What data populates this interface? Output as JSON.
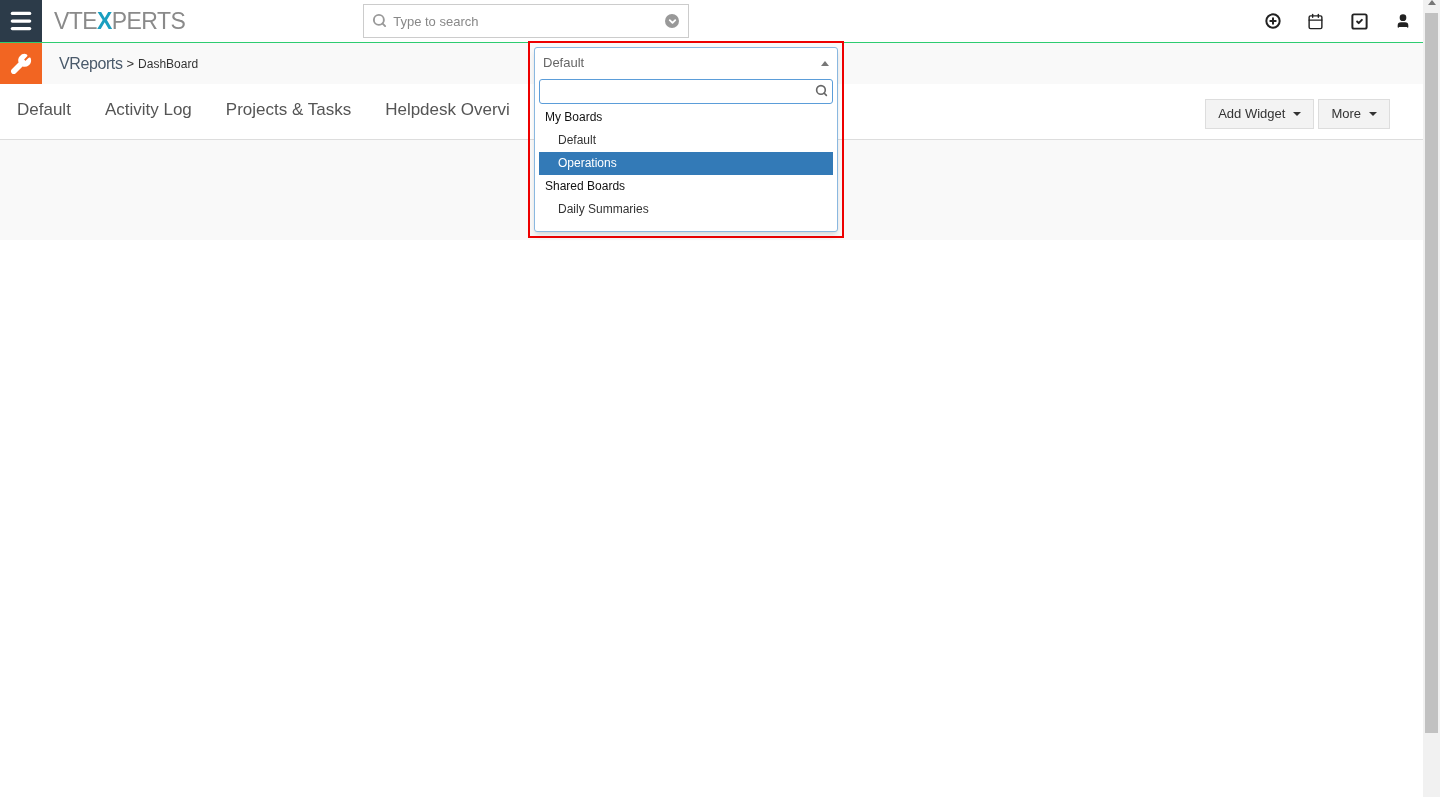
{
  "logo": {
    "parts": [
      {
        "text": "VTE",
        "accent": false
      },
      {
        "text": "X",
        "accent": true
      },
      {
        "text": "PERTS",
        "accent": false
      }
    ]
  },
  "search": {
    "placeholder": "Type to search"
  },
  "breadcrumb": {
    "module": "VReports",
    "separator": ">",
    "page": "DashBoard"
  },
  "tabs": [
    {
      "label": "Default",
      "selected": false
    },
    {
      "label": "Activity Log",
      "selected": false
    },
    {
      "label": "Projects & Tasks",
      "selected": false
    },
    {
      "label": "Helpdesk Overvi",
      "selected": false
    }
  ],
  "actions": [
    "Add Widget",
    "More"
  ],
  "board_select": {
    "value": "Default",
    "groups": [
      {
        "label": "My Boards",
        "options": [
          {
            "label": "Default",
            "selected": false
          },
          {
            "label": "Operations",
            "selected": true
          }
        ]
      },
      {
        "label": "Shared Boards",
        "options": [
          {
            "label": "Daily Summaries",
            "selected": false
          }
        ]
      }
    ]
  }
}
